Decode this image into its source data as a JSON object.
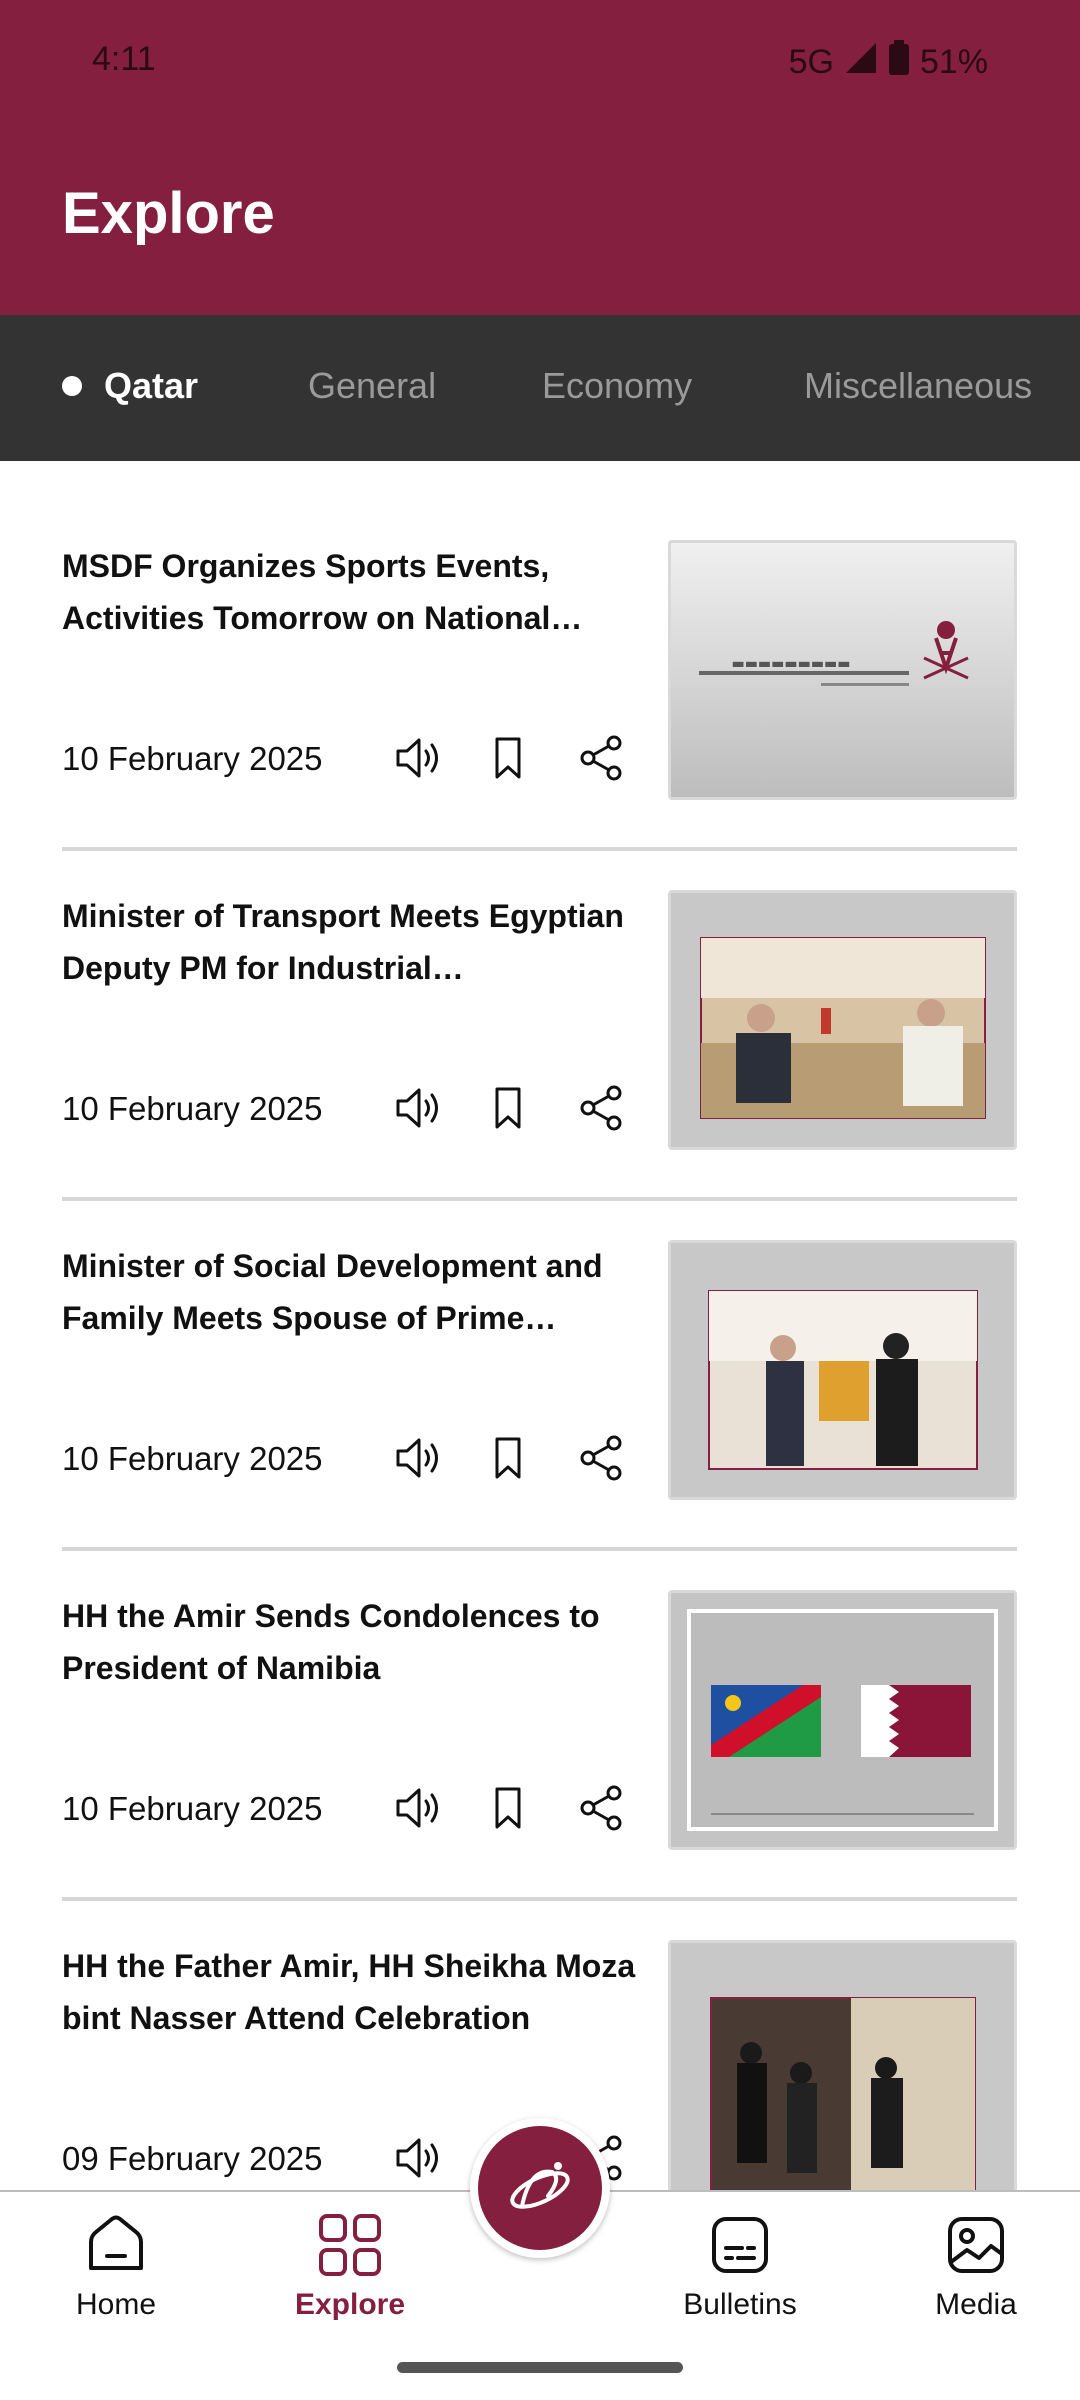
{
  "status_bar": {
    "time": "4:11",
    "network": "5G",
    "battery": "51%"
  },
  "header": {
    "title": "Explore"
  },
  "tabs": [
    {
      "label": "Qatar",
      "active": true
    },
    {
      "label": "General",
      "active": false
    },
    {
      "label": "Economy",
      "active": false
    },
    {
      "label": "Miscellaneous",
      "active": false
    }
  ],
  "articles": [
    {
      "title": "MSDF Organizes Sports Events, Activities Tomorrow on National Sport Day",
      "date": "10 February 2025",
      "image": "ministry-logo"
    },
    {
      "title": "Minister of Transport Meets Egyptian Deputy PM for Industrial Development",
      "date": "10 February 2025",
      "image": "meeting-photo"
    },
    {
      "title": "Minister of Social Development and Family Meets Spouse of Prime Minister",
      "date": "10 February 2025",
      "image": "gift-photo"
    },
    {
      "title": "HH the Amir Sends Condolences to President of Namibia",
      "date": "10 February 2025",
      "image": "flags-map"
    },
    {
      "title": "HH the Father Amir, HH Sheikha Moza bint Nasser Attend Celebration",
      "date": "09 February 2025",
      "image": "event-photo"
    }
  ],
  "bottom_nav": [
    {
      "label": "Home",
      "icon": "home-icon",
      "active": false
    },
    {
      "label": "Explore",
      "icon": "grid-icon",
      "active": true
    },
    {
      "label": "Bulletins",
      "icon": "bulletin-icon",
      "active": false
    },
    {
      "label": "Media",
      "icon": "image-icon",
      "active": false
    }
  ],
  "colors": {
    "brand": "#851f3f",
    "tab_bar": "#333333",
    "divider": "#d6d6d6"
  }
}
